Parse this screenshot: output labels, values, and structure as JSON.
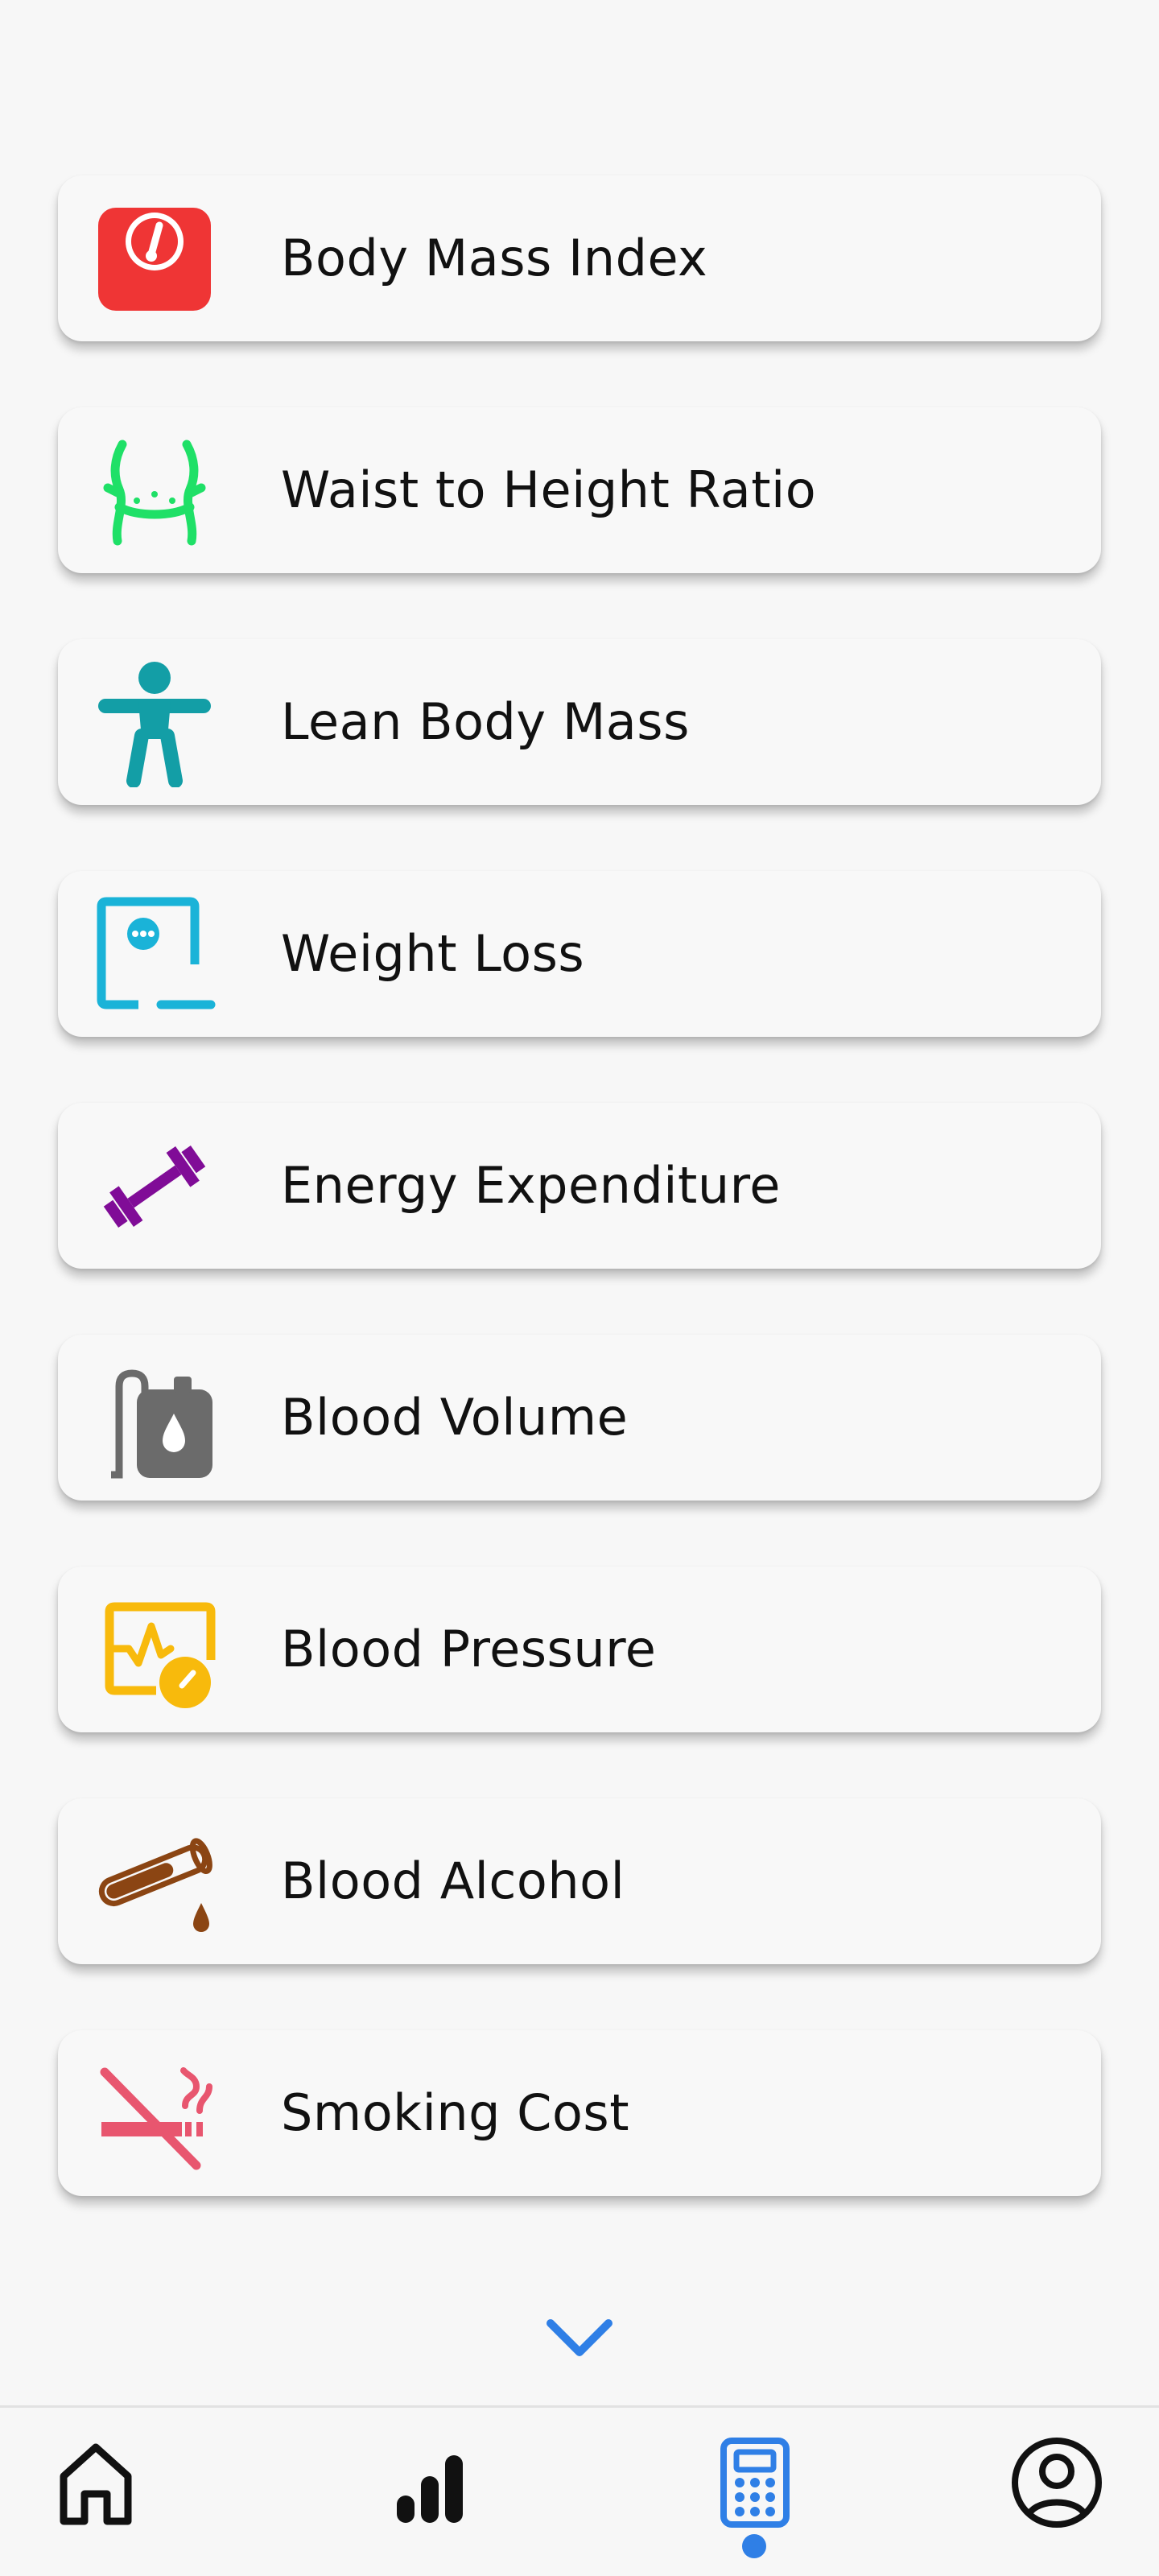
{
  "calculators": [
    {
      "label": "Body Mass Index",
      "icon": "scale-icon",
      "color": "#ef3535"
    },
    {
      "label": "Waist to Height Ratio",
      "icon": "waist-icon",
      "color": "#1fe067"
    },
    {
      "label": "Lean Body Mass",
      "icon": "accessibility-person-icon",
      "color": "#139ea6"
    },
    {
      "label": "Weight Loss",
      "icon": "weight-loss-icon",
      "color": "#1ab3d8"
    },
    {
      "label": "Energy Expenditure",
      "icon": "dumbbell-icon",
      "color": "#800c97"
    },
    {
      "label": "Blood Volume",
      "icon": "blood-bag-icon",
      "color": "#6b6b6b"
    },
    {
      "label": "Blood Pressure",
      "icon": "blood-pressure-monitor-icon",
      "color": "#f8ba0c"
    },
    {
      "label": "Blood Alcohol",
      "icon": "test-tube-drop-icon",
      "color": "#8b4513"
    },
    {
      "label": "Smoking Cost",
      "icon": "no-smoking-icon",
      "color": "#e8566f"
    }
  ],
  "scroll_hint": {
    "icon": "chevron-down-icon",
    "color": "#2f7fe6"
  },
  "bottom_nav": {
    "items": [
      {
        "name": "home",
        "icon": "home-icon",
        "active": false
      },
      {
        "name": "stats",
        "icon": "bar-chart-icon",
        "active": false
      },
      {
        "name": "calculators",
        "icon": "calculator-icon",
        "active": true
      },
      {
        "name": "profile",
        "icon": "account-circle-icon",
        "active": false
      }
    ],
    "active_color": "#2f7fe6"
  }
}
